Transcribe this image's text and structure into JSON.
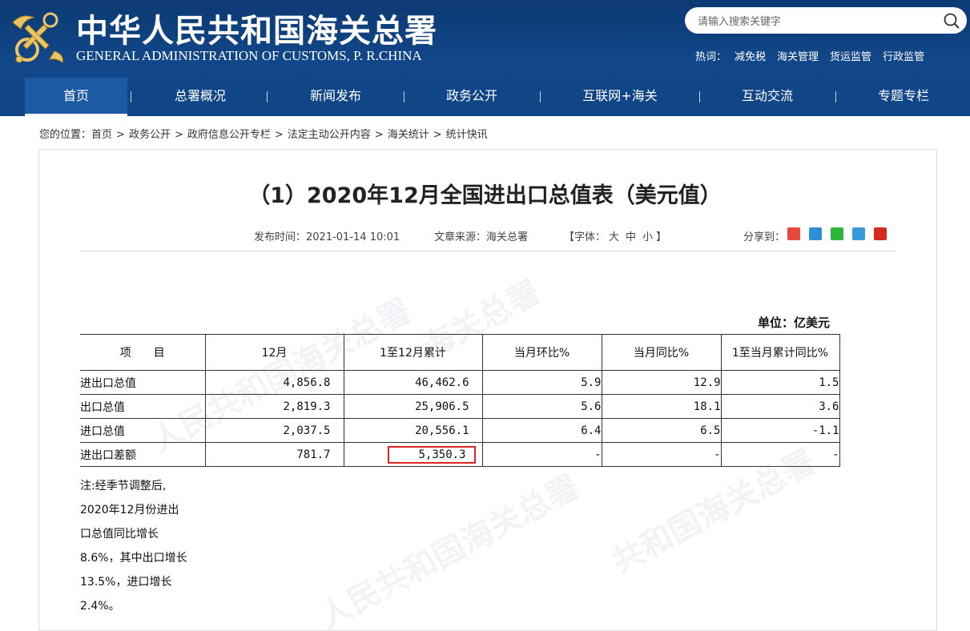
{
  "header": {
    "title_cn": "中华人民共和国海关总署",
    "title_en": "GENERAL ADMINISTRATION OF CUSTOMS, P. R.CHINA",
    "search_placeholder": "请输入搜索关键字",
    "hotwords_label": "热词：",
    "hotwords": [
      "减免税",
      "海关管理",
      "货运监管",
      "行政监管"
    ]
  },
  "nav": {
    "items": [
      "首页",
      "总署概况",
      "新闻发布",
      "政务公开",
      "互联网+海关",
      "互动交流",
      "专题专栏"
    ],
    "active": "首页"
  },
  "breadcrumb": {
    "prefix": "您的位置：",
    "items": [
      "首页",
      "政务公开",
      "政府信息公开专栏",
      "法定主动公开内容",
      "海关统计",
      "统计快讯"
    ],
    "separator": ">"
  },
  "article": {
    "title": "（1）2020年12月全国进出口总值表（美元值）",
    "publish_label": "发布时间：",
    "publish_time": "2021-01-14 10:01",
    "source_label": "文章来源：",
    "source": "海关总署",
    "font_label": "【字体：",
    "font_sizes": [
      "大",
      "中",
      "小"
    ],
    "font_close": "】",
    "share_label": "分享到：",
    "share_icons": [
      "weibo-icon",
      "qzone-icon",
      "wechat-icon",
      "renren-icon",
      "people-icon"
    ]
  },
  "table": {
    "unit": "单位：亿美元",
    "headers": [
      "项　　目",
      "12月",
      "1至12月累计",
      "当月环比%",
      "当月同比%",
      "1至当月累计同比%"
    ],
    "rows": [
      [
        "进出口总值",
        "4,856.8",
        "46,462.6",
        "5.9",
        "12.9",
        "1.5"
      ],
      [
        "出口总值",
        "2,819.3",
        "25,906.5",
        "5.6",
        "18.1",
        "3.6"
      ],
      [
        "进口总值",
        "2,037.5",
        "20,556.1",
        "6.4",
        "6.5",
        "-1.1"
      ],
      [
        "进出口差额",
        "781.7",
        "5,350.3",
        "-",
        "-",
        "-"
      ]
    ],
    "highlight_color": "#e0241f"
  },
  "note": {
    "lines": [
      "注:经季节调整后,",
      "2020年12月份进出",
      "口总值同比增长",
      "8.6%，其中出口增长",
      "13.5%，进口增长",
      "2.4%。"
    ]
  }
}
